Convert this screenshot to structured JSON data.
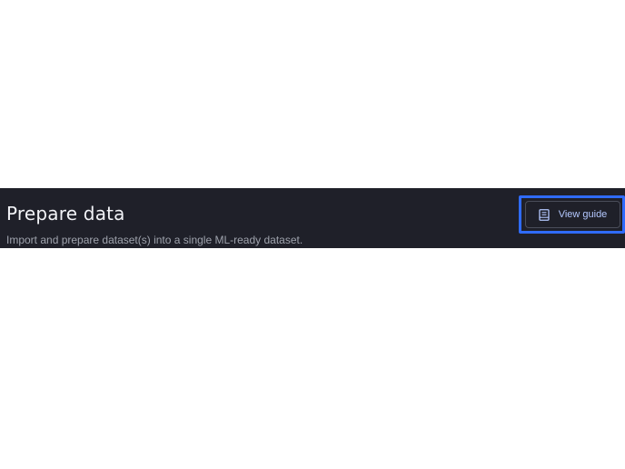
{
  "header": {
    "title": "Prepare data",
    "subtitle": "Import and prepare dataset(s) into a single ML-ready dataset.",
    "guide_button": {
      "label": "View guide",
      "icon": "book-icon",
      "focused": true
    }
  },
  "colors": {
    "header_background": "#1f2029",
    "title_text": "#f2f3f7",
    "subtitle_text": "#9fa3ad",
    "button_text": "#b4c8ff",
    "focus_ring": "#2f6bff"
  }
}
